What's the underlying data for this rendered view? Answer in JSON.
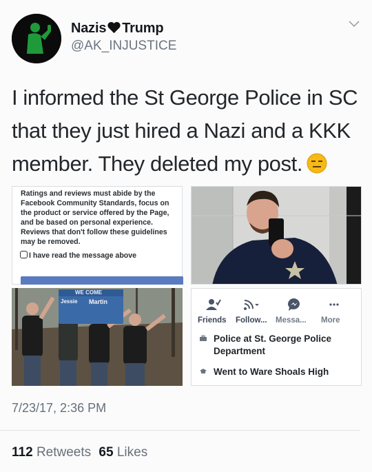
{
  "tweet": {
    "display_name_left": "Nazis",
    "display_name_right": "Trump",
    "handle": "@AK_INJUSTICE",
    "text": "I informed the St George Police in SC that they just hired a Nazi and a KKK member.  They deleted my post.",
    "timestamp": "7/23/17, 2:36 PM"
  },
  "stats": {
    "retweets_count": "112",
    "retweets_label": "Retweets",
    "likes_count": "65",
    "likes_label": "Likes"
  },
  "screenshot_rules": {
    "text": "Ratings and reviews must abide by the Facebook Community Standards, focus on the product or service offered by the Page, and be based on personal experience. Reviews that don't follow these guidelines may be removed.",
    "checkbox_label": "I have read the message above"
  },
  "group_photo": {
    "sign_line1": "WE COME",
    "sign_name1": "Jessie",
    "sign_name2": "Martin"
  },
  "profile_card": {
    "actions": [
      "Friends",
      "Follow...",
      "Messa...",
      "More"
    ],
    "work": "Police at St. George Police Department",
    "education": "Went to Ware Shoals High"
  },
  "icons": [
    "avatar-thumbs-up",
    "black-heart-icon",
    "chevron-down-icon",
    "expressionless-emoji",
    "friends-icon",
    "follow-rss-icon",
    "messenger-icon",
    "more-dots-icon",
    "briefcase-icon",
    "graduation-cap-icon"
  ],
  "colors": {
    "heart": "#111111",
    "emoji": "#f6b915",
    "avatar_figure": "#1f9a3a",
    "facebook_blue": "#5b7bc0"
  }
}
